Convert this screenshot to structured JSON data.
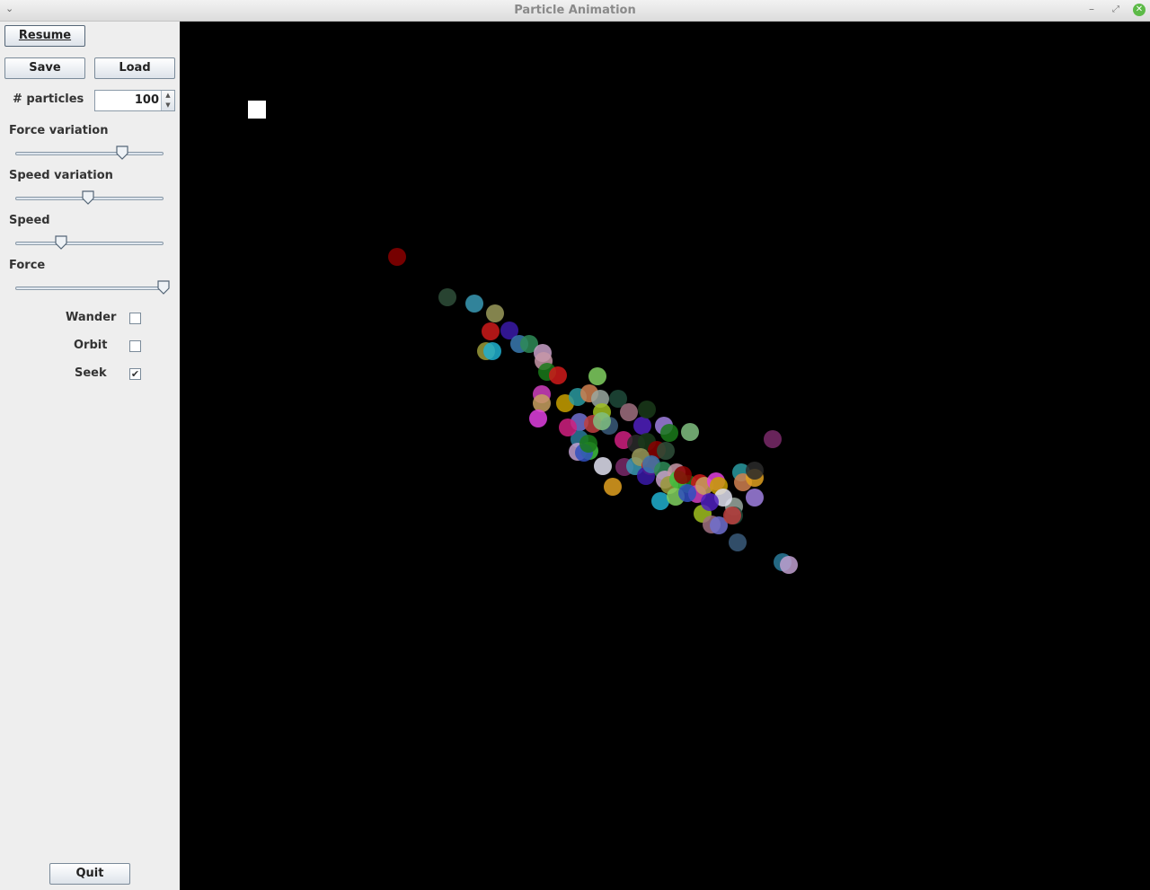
{
  "window": {
    "title": "Particle Animation"
  },
  "controls": {
    "resume_label": "Resume",
    "save_label": "Save",
    "load_label": "Load",
    "particles_label": "# particles",
    "particles_value": "100",
    "quit_label": "Quit"
  },
  "sliders": [
    {
      "label": "Force variation",
      "value": 0.72
    },
    {
      "label": "Speed variation",
      "value": 0.49
    },
    {
      "label": "Speed",
      "value": 0.31
    },
    {
      "label": "Force",
      "value": 1.0
    }
  ],
  "checkboxes": [
    {
      "label": "Wander",
      "checked": false
    },
    {
      "label": "Orbit",
      "checked": false
    },
    {
      "label": "Seek",
      "checked": true
    }
  ],
  "particle_colors": [
    "#8b0000",
    "#2f4f3a",
    "#3a9ab5",
    "#9a9a5a",
    "#cc1a1a",
    "#3a1aa8",
    "#3a7ab0",
    "#2e8b57",
    "#c8a0c8",
    "#c898a8",
    "#1a7a1a",
    "#d01a1a",
    "#9a9a3a",
    "#20b0d0",
    "#80d060",
    "#d040c0",
    "#c8a060",
    "#e040e0",
    "#c8a000",
    "#2a9aa0",
    "#d08050",
    "#9aa8a0",
    "#1e4a3a",
    "#a0c020",
    "#a07080",
    "#7070d0",
    "#c04040",
    "#3a5a7a",
    "#2a7a9a",
    "#c0a0d0",
    "#40c040",
    "#3050c0",
    "#e0e0f0",
    "#e0a020",
    "#7a2a6a",
    "#d02080",
    "#2a2a2a",
    "#5020c0",
    "#a080e0",
    "#1a7a1a",
    "#80c080",
    "#1a3a1a"
  ]
}
